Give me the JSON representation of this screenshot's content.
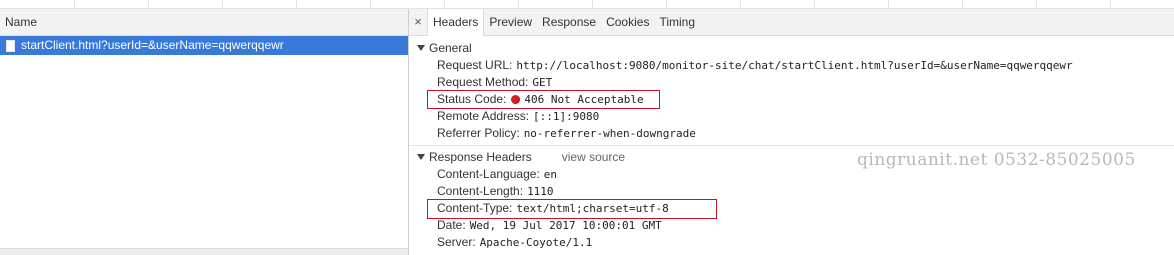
{
  "left_panel": {
    "header": "Name",
    "selected_request": "startClient.html?userId=&userName=qqwerqqewr"
  },
  "tabs": {
    "close": "×",
    "items": [
      "Headers",
      "Preview",
      "Response",
      "Cookies",
      "Timing"
    ],
    "active": "Headers"
  },
  "general": {
    "title": "General",
    "request_url": {
      "key": "Request URL:",
      "value": "http://localhost:9080/monitor-site/chat/startClient.html?userId=&userName=qqwerqqewr"
    },
    "request_method": {
      "key": "Request Method:",
      "value": "GET"
    },
    "status_code": {
      "key": "Status Code:",
      "value": "406 Not Acceptable",
      "status_color": "#d92020"
    },
    "remote_address": {
      "key": "Remote Address:",
      "value": "[::1]:9080"
    },
    "referrer_policy": {
      "key": "Referrer Policy:",
      "value": "no-referrer-when-downgrade"
    }
  },
  "response_headers": {
    "title": "Response Headers",
    "view_source": "view source",
    "content_language": {
      "key": "Content-Language:",
      "value": "en"
    },
    "content_length": {
      "key": "Content-Length:",
      "value": "1110"
    },
    "content_type": {
      "key": "Content-Type:",
      "value": "text/html;charset=utf-8"
    },
    "date": {
      "key": "Date:",
      "value": "Wed, 19 Jul 2017 10:00:01 GMT"
    },
    "server": {
      "key": "Server:",
      "value": "Apache-Coyote/1.1"
    }
  },
  "watermark": "qingruanit.net 0532-85025005",
  "colors": {
    "selection": "#3879d9",
    "highlight_box": "#c8102e"
  }
}
